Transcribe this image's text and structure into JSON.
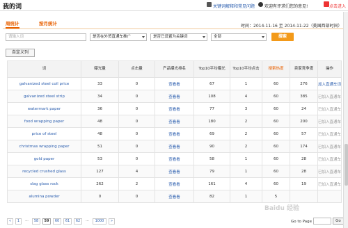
{
  "header": {
    "title": "我的词",
    "help_link": "关键词解释和常见问题",
    "feedback": "欢迎有评求们您的意见!",
    "gift_link": "点击进入"
  },
  "tabs": [
    {
      "label": "周统计",
      "active": true
    },
    {
      "label": "按月统计",
      "active": false
    }
  ],
  "time_range": "时间：2014-11-16 至 2014-11-22（美国西部时间）",
  "filters": {
    "keyword_placeholder": "请输入词",
    "promo_select": "是否在外贸直通车推广",
    "key_word_select": "是否已设置为关键词",
    "all_select": "全部",
    "search_button": "搜索"
  },
  "custom_columns_button": "自定义列",
  "table": {
    "columns": [
      "词",
      "曝光量",
      "点击量",
      "产品曝光排名",
      "Top10平均曝光",
      "Top10平均点击",
      "搜索热度",
      "卖家竞争度",
      "操作"
    ],
    "rows": [
      {
        "word": "galvanized steel coil price",
        "impressions": "33",
        "clicks": "0",
        "rank": "查看看",
        "top10_imp": "67",
        "top10_clk": "1",
        "heat": "60",
        "competition": "276",
        "action": "加入直通车词库",
        "action_done": false
      },
      {
        "word": "galvanized steel strip",
        "impressions": "34",
        "clicks": "0",
        "rank": "查看看",
        "top10_imp": "108",
        "top10_clk": "4",
        "heat": "60",
        "competition": "385",
        "action": "已加入直通车词库",
        "action_done": true
      },
      {
        "word": "watermark paper",
        "impressions": "36",
        "clicks": "0",
        "rank": "查看看",
        "top10_imp": "77",
        "top10_clk": "3",
        "heat": "60",
        "competition": "24",
        "action": "已加入直通车词库",
        "action_done": true
      },
      {
        "word": "food wrapping paper",
        "impressions": "48",
        "clicks": "0",
        "rank": "查看看",
        "top10_imp": "180",
        "top10_clk": "2",
        "heat": "60",
        "competition": "200",
        "action": "已加入直通车词库",
        "action_done": true
      },
      {
        "word": "price of steel",
        "impressions": "48",
        "clicks": "0",
        "rank": "查看看",
        "top10_imp": "69",
        "top10_clk": "2",
        "heat": "60",
        "competition": "57",
        "action": "已加入直通车词库",
        "action_done": true
      },
      {
        "word": "christmas wrapping paper",
        "impressions": "51",
        "clicks": "0",
        "rank": "查看看",
        "top10_imp": "90",
        "top10_clk": "2",
        "heat": "60",
        "competition": "174",
        "action": "已加入直通车词库",
        "action_done": true
      },
      {
        "word": "gold paper",
        "impressions": "53",
        "clicks": "0",
        "rank": "查看看",
        "top10_imp": "58",
        "top10_clk": "1",
        "heat": "60",
        "competition": "28",
        "action": "已加入直通车词库",
        "action_done": true
      },
      {
        "word": "recycled crushed glass",
        "impressions": "127",
        "clicks": "4",
        "rank": "查看看",
        "top10_imp": "79",
        "top10_clk": "1",
        "heat": "60",
        "competition": "28",
        "action": "已加入直通车词库",
        "action_done": true
      },
      {
        "word": "slag glass rock",
        "impressions": "262",
        "clicks": "2",
        "rank": "查看看",
        "top10_imp": "161",
        "top10_clk": "4",
        "heat": "60",
        "competition": "19",
        "action": "已加入直通车词库",
        "action_done": true
      },
      {
        "word": "alumina powder",
        "impressions": "0",
        "clicks": "0",
        "rank": "查看看",
        "top10_imp": "82",
        "top10_clk": "1",
        "heat": "5",
        "competition": "",
        "action": "",
        "action_done": true
      }
    ]
  },
  "pagination": {
    "prev": "«",
    "pages": [
      "1",
      "...",
      "58",
      "59",
      "60",
      "61",
      "62",
      "...",
      "1000",
      "»"
    ],
    "current": "59",
    "goto_label": "Go to Page",
    "go_button": "Go"
  },
  "watermark": "Baidu 经验"
}
